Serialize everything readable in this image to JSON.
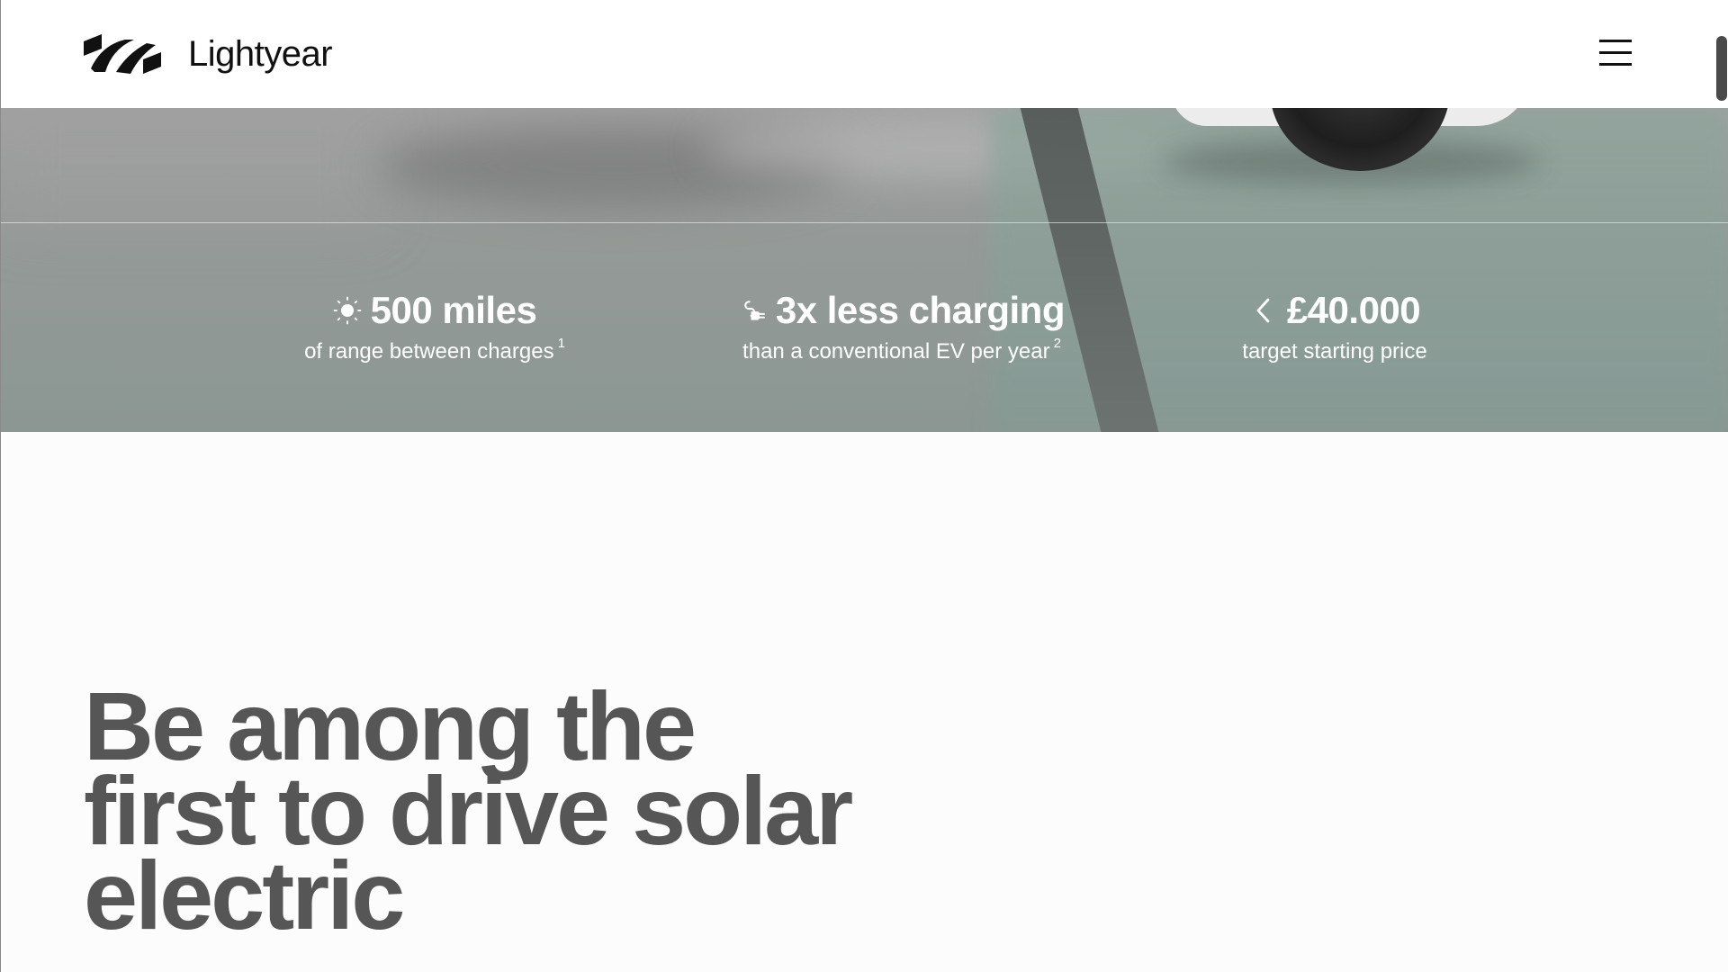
{
  "header": {
    "brand_name": "Lightyear",
    "logo_icon": "lightyear-logo-icon",
    "menu_icon": "hamburger-menu-icon"
  },
  "stats": [
    {
      "icon": "sun-icon",
      "headline": "500 miles",
      "caption": "of range between charges",
      "footnote": "1"
    },
    {
      "icon": "plug-icon",
      "headline": "3x less charging",
      "caption": "than a conventional EV per year",
      "footnote": "2"
    },
    {
      "icon": "chevron-left-icon",
      "headline": "£40.000",
      "caption": "target starting price",
      "footnote": ""
    }
  ],
  "cta": {
    "heading_lines": [
      "Be among the",
      "first to drive solar",
      "electric"
    ]
  },
  "colors": {
    "header_bg": "#ffffff",
    "brand_text": "#111111",
    "heading_text": "#565656",
    "stat_text": "#ffffff",
    "page_bg": "#fcfcfc"
  }
}
